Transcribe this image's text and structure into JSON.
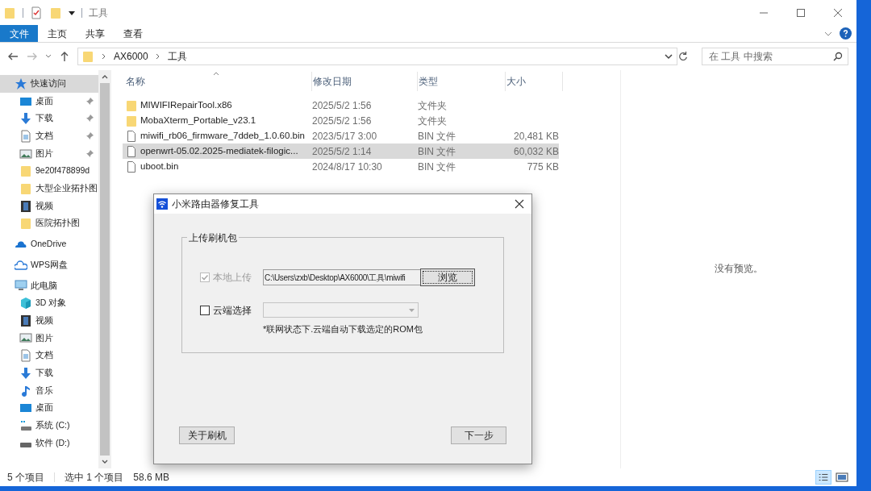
{
  "window": {
    "title": "工具"
  },
  "ribbon_tabs": [
    {
      "label": "文件",
      "selected": true
    },
    {
      "label": "主页",
      "selected": false
    },
    {
      "label": "共享",
      "selected": false
    },
    {
      "label": "查看",
      "selected": false
    }
  ],
  "address": {
    "path": [
      "AX6000",
      "工具"
    ],
    "search_placeholder": "在 工具 中搜索"
  },
  "sidebar": {
    "items": [
      {
        "label": "快速访问",
        "kind": "star",
        "selected": true,
        "pinned": false,
        "top": true
      },
      {
        "label": "桌面",
        "kind": "desktop",
        "selected": false,
        "pinned": true,
        "top": false
      },
      {
        "label": "下载",
        "kind": "download",
        "selected": false,
        "pinned": true,
        "top": false
      },
      {
        "label": "文档",
        "kind": "document",
        "selected": false,
        "pinned": true,
        "top": false
      },
      {
        "label": "图片",
        "kind": "picture",
        "selected": false,
        "pinned": true,
        "top": false
      },
      {
        "label": "9e20f478899d",
        "kind": "folder",
        "selected": false,
        "pinned": false,
        "top": false
      },
      {
        "label": "大型企业拓扑图",
        "kind": "folder",
        "selected": false,
        "pinned": false,
        "top": false
      },
      {
        "label": "视频",
        "kind": "video",
        "selected": false,
        "pinned": false,
        "top": false
      },
      {
        "label": "医院拓扑图",
        "kind": "folder",
        "selected": false,
        "pinned": false,
        "top": false
      },
      {
        "label": "OneDrive",
        "kind": "cloud",
        "selected": false,
        "pinned": false,
        "top": true
      },
      {
        "label": "WPS网盘",
        "kind": "cloud-outline",
        "selected": false,
        "pinned": false,
        "top": true
      },
      {
        "label": "此电脑",
        "kind": "pc",
        "selected": false,
        "pinned": false,
        "top": true
      },
      {
        "label": "3D 对象",
        "kind": "cube",
        "selected": false,
        "pinned": false,
        "top": false
      },
      {
        "label": "视频",
        "kind": "video",
        "selected": false,
        "pinned": false,
        "top": false
      },
      {
        "label": "图片",
        "kind": "picture",
        "selected": false,
        "pinned": false,
        "top": false
      },
      {
        "label": "文档",
        "kind": "document",
        "selected": false,
        "pinned": false,
        "top": false
      },
      {
        "label": "下载",
        "kind": "download",
        "selected": false,
        "pinned": false,
        "top": false
      },
      {
        "label": "音乐",
        "kind": "music",
        "selected": false,
        "pinned": false,
        "top": false
      },
      {
        "label": "桌面",
        "kind": "desktop",
        "selected": false,
        "pinned": false,
        "top": false
      },
      {
        "label": "系统 (C:)",
        "kind": "drive-system",
        "selected": false,
        "pinned": false,
        "top": false
      },
      {
        "label": "软件 (D:)",
        "kind": "drive",
        "selected": false,
        "pinned": false,
        "top": false
      }
    ]
  },
  "table": {
    "columns": [
      "名称",
      "修改日期",
      "类型",
      "大小"
    ],
    "rows": [
      {
        "kind": "folder",
        "name": "MIWIFIRepairTool.x86",
        "date": "2025/5/2 1:56",
        "type": "文件夹",
        "selected": false
      },
      {
        "kind": "folder",
        "name": "MobaXterm_Portable_v23.1",
        "date": "2025/5/2 1:56",
        "type": "文件夹",
        "selected": false
      },
      {
        "kind": "file",
        "name": "miwifi_rb06_firmware_7ddeb_1.0.60.bin",
        "date": "2023/5/17 3:00",
        "type": "BIN 文件",
        "size": "20,481 KB",
        "selected": false
      },
      {
        "kind": "file",
        "name": "openwrt-05.02.2025-mediatek-filogic...",
        "date": "2025/5/2 1:14",
        "type": "BIN 文件",
        "size": "60,032 KB",
        "selected": true
      },
      {
        "kind": "file",
        "name": "uboot.bin",
        "date": "2024/8/17 10:30",
        "type": "BIN 文件",
        "size": "775 KB",
        "selected": false
      }
    ]
  },
  "preview": {
    "text": "没有预览。"
  },
  "status_bar": {
    "count": "5 个项目",
    "selection": "选中 1 个项目",
    "size": "58.6 MB"
  },
  "dialog": {
    "title": "小米路由器修复工具",
    "group": "上传刷机包",
    "local": {
      "label": "本地上传",
      "checked": true,
      "disabled": true,
      "value": "C:\\Users\\zxb\\Desktop\\AX6000\\工具\\miwifi",
      "button": "浏览"
    },
    "cloud": {
      "label": "云端选择",
      "checked": false,
      "disabled": false
    },
    "note": "*联网状态下.云端自动下载选定的ROM包",
    "buttons": [
      "关于刷机",
      "下一步"
    ]
  }
}
